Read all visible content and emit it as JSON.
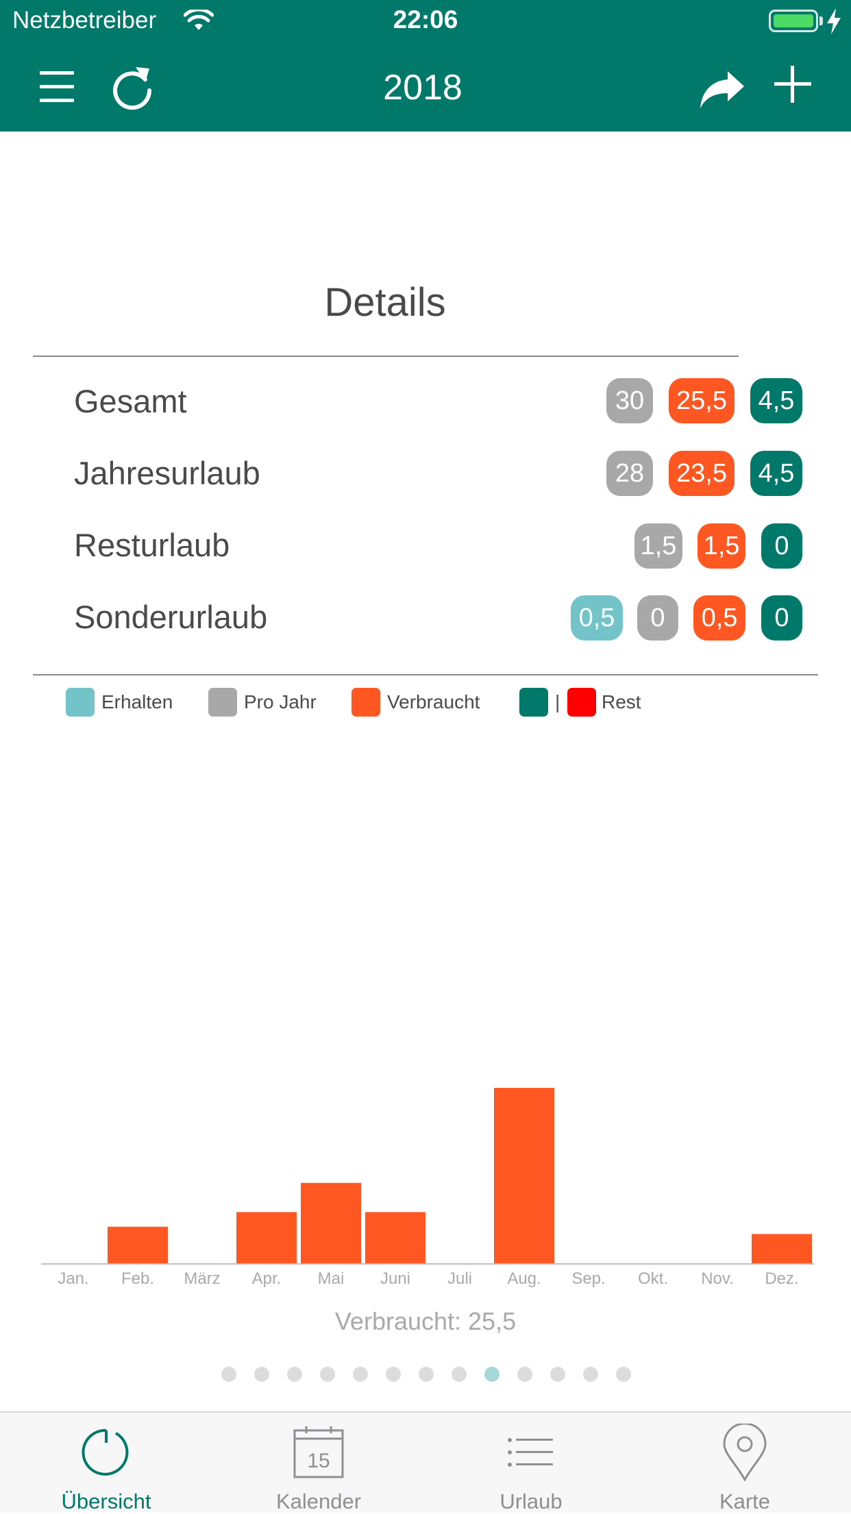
{
  "status_bar": {
    "carrier": "Netzbetreiber",
    "time": "22:06",
    "battery_level": 1.0
  },
  "nav": {
    "title": "2018",
    "menu_icon": "hamburger-icon",
    "refresh_icon": "refresh-icon",
    "share_icon": "share-icon",
    "add_icon": "plus-icon"
  },
  "details": {
    "title": "Details",
    "rows": [
      {
        "label": "Gesamt",
        "badges": [
          {
            "value": "30",
            "kind": "pro_jahr"
          },
          {
            "value": "25,5",
            "kind": "verbraucht"
          },
          {
            "value": "4,5",
            "kind": "rest"
          }
        ]
      },
      {
        "label": "Jahresurlaub",
        "badges": [
          {
            "value": "28",
            "kind": "pro_jahr"
          },
          {
            "value": "23,5",
            "kind": "verbraucht"
          },
          {
            "value": "4,5",
            "kind": "rest"
          }
        ]
      },
      {
        "label": "Resturlaub",
        "badges": [
          {
            "value": "1,5",
            "kind": "pro_jahr"
          },
          {
            "value": "1,5",
            "kind": "verbraucht"
          },
          {
            "value": "0",
            "kind": "rest"
          }
        ]
      },
      {
        "label": "Sonderurlaub",
        "badges": [
          {
            "value": "0,5",
            "kind": "erhalten"
          },
          {
            "value": "0",
            "kind": "pro_jahr"
          },
          {
            "value": "0,5",
            "kind": "verbraucht"
          },
          {
            "value": "0",
            "kind": "rest"
          }
        ]
      }
    ]
  },
  "legend": {
    "erhalten": "Erhalten",
    "pro_jahr": "Pro Jahr",
    "verbraucht": "Verbraucht",
    "separator": "|",
    "rest": "Rest"
  },
  "colors": {
    "header": "#00786a",
    "erhalten": "#72c4c9",
    "pro_jahr": "#a8a8a8",
    "verbraucht": "#ff5722",
    "rest": "#00786a",
    "rest_negative": "#ff0000",
    "dot": "#dcdcdc",
    "dot_active": "#a7d8d8",
    "tab_active": "#00786a",
    "tab_inactive": "#8e8e93"
  },
  "chart_data": {
    "type": "bar",
    "categories": [
      "Jan.",
      "Feb.",
      "März",
      "Apr.",
      "Mai",
      "Juni",
      "Juli",
      "Aug.",
      "Sep.",
      "Okt.",
      "Nov.",
      "Dez."
    ],
    "values": [
      0,
      2.5,
      0,
      3.5,
      5.5,
      3.5,
      0,
      12,
      0,
      0,
      0,
      2
    ],
    "color": "#ff5722",
    "ylim": [
      0,
      12
    ]
  },
  "caption": "Verbraucht: 25,5",
  "pager": {
    "count": 13,
    "active_index": 8
  },
  "tabs": [
    {
      "label": "Übersicht",
      "icon": "overview-icon",
      "active": true
    },
    {
      "label": "Kalender",
      "icon": "calendar-icon",
      "day": "15",
      "active": false
    },
    {
      "label": "Urlaub",
      "icon": "list-icon",
      "active": false
    },
    {
      "label": "Karte",
      "icon": "map-pin-icon",
      "active": false
    }
  ]
}
